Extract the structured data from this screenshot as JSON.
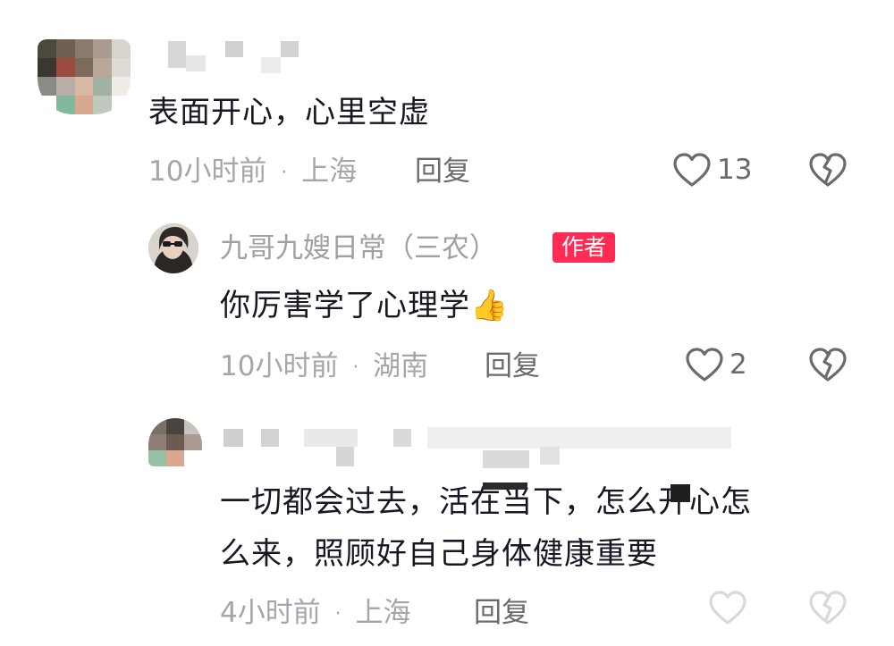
{
  "comments": [
    {
      "text": "表面开心，心里空虚",
      "time": "10小时前",
      "location": "上海",
      "reply_label": "回复",
      "likes": "13"
    }
  ],
  "reply1": {
    "author": "九哥九嫂日常（三农）",
    "badge": "作者",
    "text": "你厉害学了心理学",
    "emoji": "👍",
    "time": "10小时前",
    "location": "湖南",
    "reply_label": "回复",
    "likes": "2"
  },
  "reply2": {
    "text_line1": "一切都会过去，活在当下，怎么开心怎",
    "text_line2": "么来，照顾好自己身体健康重要",
    "time": "4小时前",
    "location": "上海",
    "reply_label": "回复"
  },
  "separator": "·",
  "icons": {
    "like": "heart-outline-icon",
    "dislike": "broken-heart-icon",
    "thumbs_up": "thumbs-up-emoji"
  },
  "colors": {
    "badge": "#fe2c55",
    "meta": "#a5a6ab",
    "text": "#161823"
  }
}
